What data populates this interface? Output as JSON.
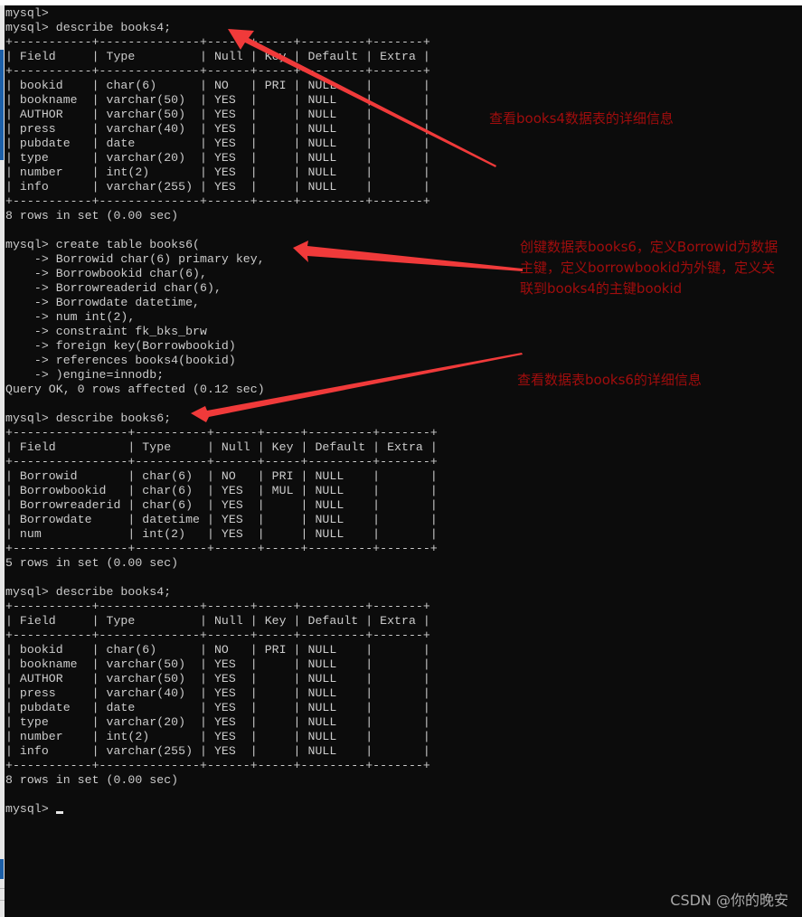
{
  "terminal": {
    "prompt": "mysql>",
    "lines": [
      "mysql>",
      "mysql> describe books4;",
      "+-----------+--------------+------+-----+---------+-------+",
      "| Field     | Type         | Null | Key | Default | Extra |",
      "+-----------+--------------+------+-----+---------+-------+",
      "| bookid    | char(6)      | NO   | PRI | NULL    |       |",
      "| bookname  | varchar(50)  | YES  |     | NULL    |       |",
      "| AUTHOR    | varchar(50)  | YES  |     | NULL    |       |",
      "| press     | varchar(40)  | YES  |     | NULL    |       |",
      "| pubdate   | date         | YES  |     | NULL    |       |",
      "| type      | varchar(20)  | YES  |     | NULL    |       |",
      "| number    | int(2)       | YES  |     | NULL    |       |",
      "| info      | varchar(255) | YES  |     | NULL    |       |",
      "+-----------+--------------+------+-----+---------+-------+",
      "8 rows in set (0.00 sec)",
      "",
      "mysql> create table books6(",
      "    -> Borrowid char(6) primary key,",
      "    -> Borrowbookid char(6),",
      "    -> Borrowreaderid char(6),",
      "    -> Borrowdate datetime,",
      "    -> num int(2),",
      "    -> constraint fk_bks_brw",
      "    -> foreign key(Borrowbookid)",
      "    -> references books4(bookid)",
      "    -> )engine=innodb;",
      "Query OK, 0 rows affected (0.12 sec)",
      "",
      "mysql> describe books6;",
      "+----------------+----------+------+-----+---------+-------+",
      "| Field          | Type     | Null | Key | Default | Extra |",
      "+----------------+----------+------+-----+---------+-------+",
      "| Borrowid       | char(6)  | NO   | PRI | NULL    |       |",
      "| Borrowbookid   | char(6)  | YES  | MUL | NULL    |       |",
      "| Borrowreaderid | char(6)  | YES  |     | NULL    |       |",
      "| Borrowdate     | datetime | YES  |     | NULL    |       |",
      "| num            | int(2)   | YES  |     | NULL    |       |",
      "+----------------+----------+------+-----+---------+-------+",
      "5 rows in set (0.00 sec)",
      "",
      "mysql> describe books4;",
      "+-----------+--------------+------+-----+---------+-------+",
      "| Field     | Type         | Null | Key | Default | Extra |",
      "+-----------+--------------+------+-----+---------+-------+",
      "| bookid    | char(6)      | NO   | PRI | NULL    |       |",
      "| bookname  | varchar(50)  | YES  |     | NULL    |       |",
      "| AUTHOR    | varchar(50)  | YES  |     | NULL    |       |",
      "| press     | varchar(40)  | YES  |     | NULL    |       |",
      "| pubdate   | date         | YES  |     | NULL    |       |",
      "| type      | varchar(20)  | YES  |     | NULL    |       |",
      "| number    | int(2)       | YES  |     | NULL    |       |",
      "| info      | varchar(255) | YES  |     | NULL    |       |",
      "+-----------+--------------+------+-----+---------+-------+",
      "8 rows in set (0.00 sec)",
      ""
    ],
    "current_prompt": "mysql> "
  },
  "annotations": {
    "describe_books4": "查看books4数据表的详细信息",
    "create_books6": [
      "创键数据表books6，定义Borrowid为数据",
      "主键，定义borrowbookid为外键，定义关",
      "联到books4的主键bookid"
    ],
    "describe_books6": "查看数据表books6的详细信息"
  },
  "colors": {
    "terminal_bg": "#0c0c0c",
    "terminal_text": "#cccccc",
    "annotation_text": "#a00d0d",
    "arrow": "#f03a3a",
    "watermark": "#a8a8a8"
  },
  "watermark": "CSDN @你的晚安"
}
